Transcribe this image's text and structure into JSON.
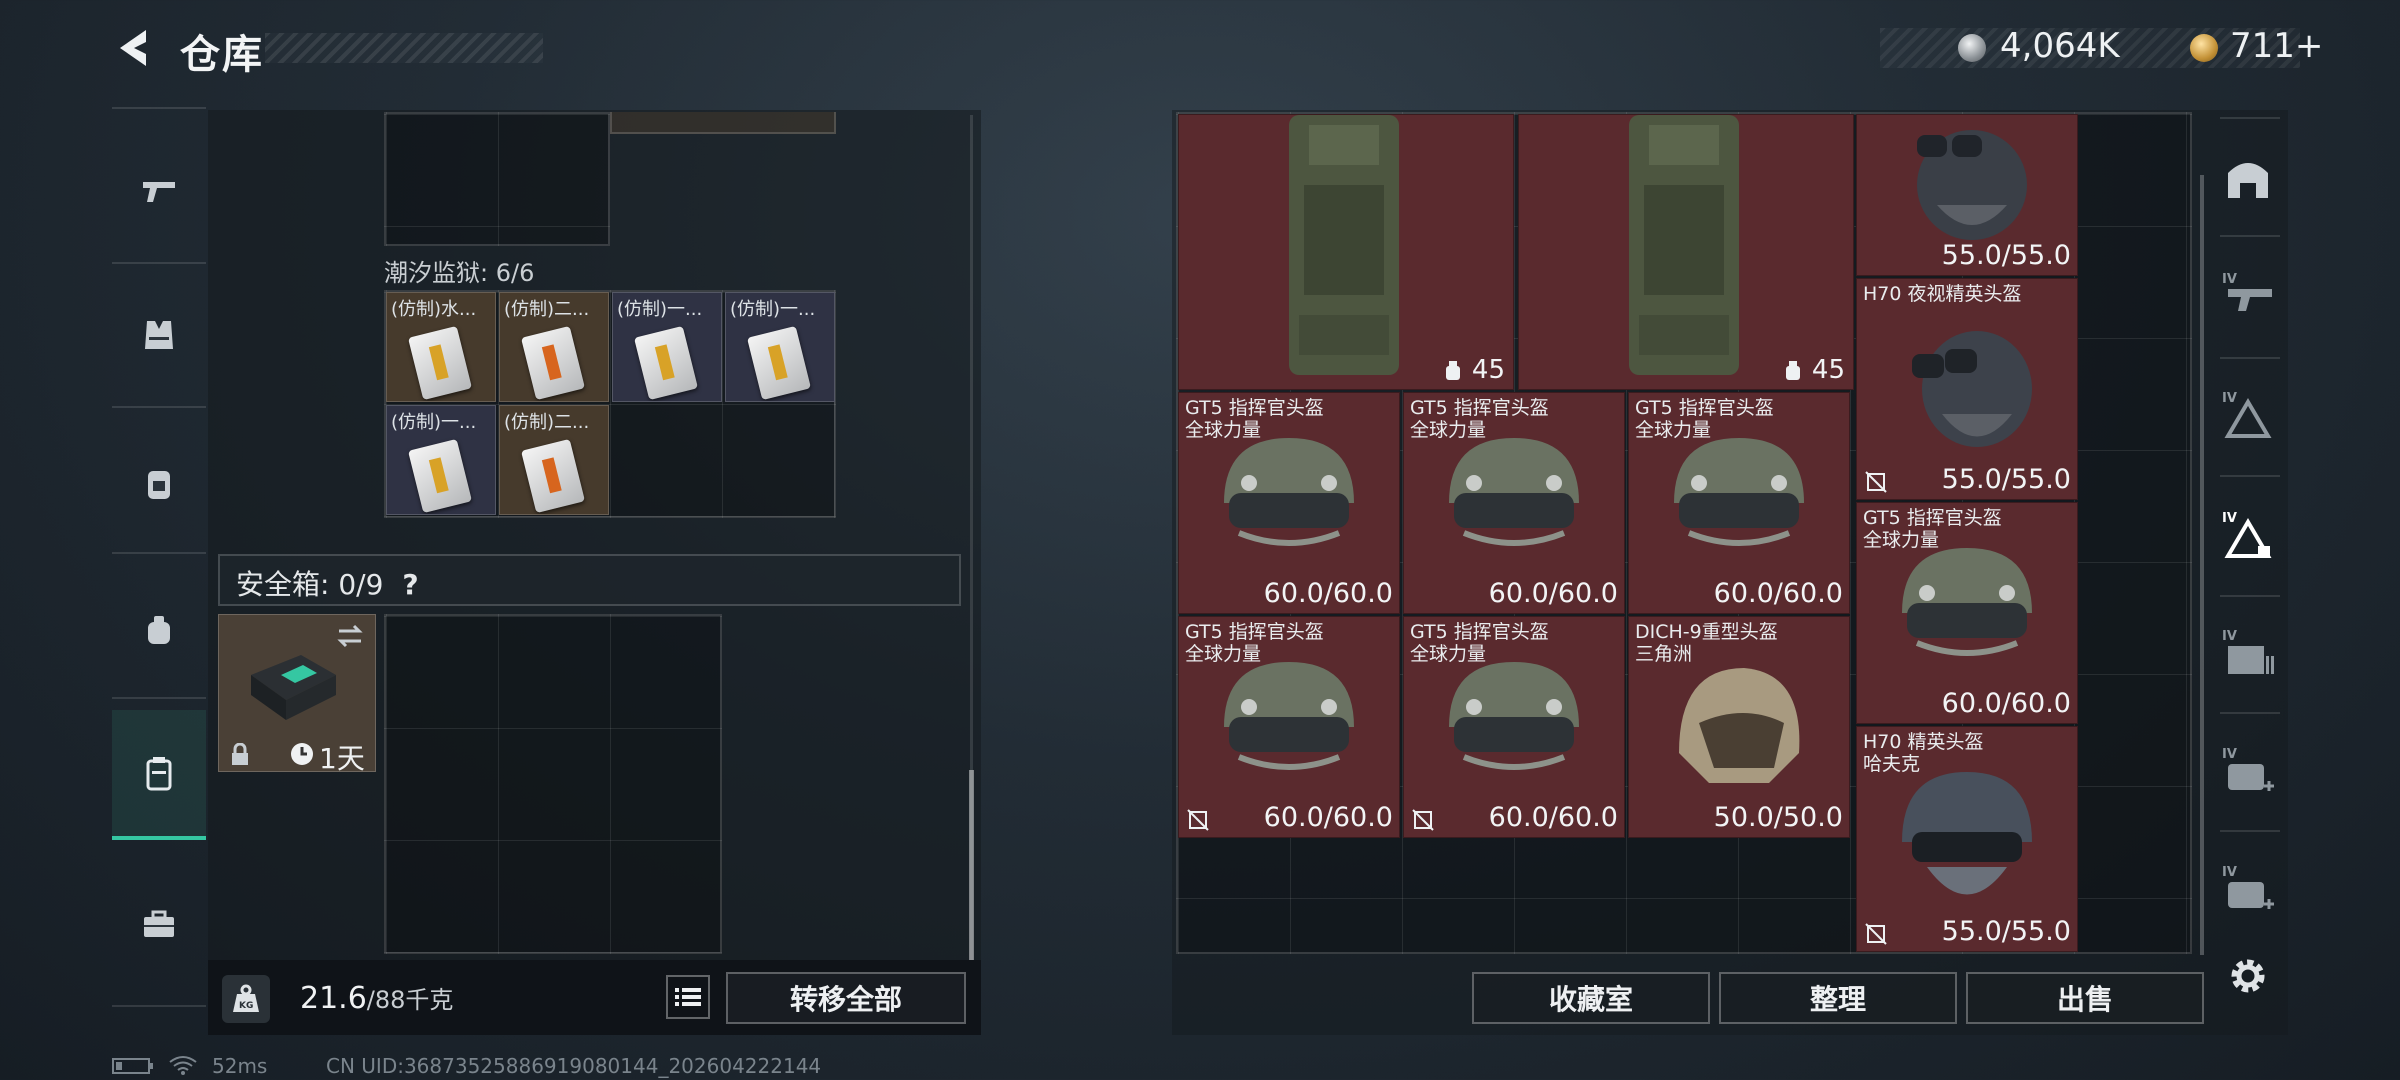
{
  "header": {
    "title": "仓库",
    "currency": [
      {
        "name": "silver-coin-icon",
        "amount": "4,064K"
      },
      {
        "name": "gold-coin-icon",
        "amount": "711+"
      }
    ]
  },
  "left_nav": {
    "icons": [
      "pistol-icon",
      "vest-icon",
      "backpack-icon",
      "pouch-icon",
      "safe-case-icon",
      "briefcase-icon"
    ],
    "active": "safe-case-icon"
  },
  "storage": {
    "prison_label": "潮汐监狱: 6/6",
    "cards": [
      {
        "label": "(仿制)水...",
        "color": "brown",
        "stripe": "y"
      },
      {
        "label": "(仿制)二...",
        "color": "brown",
        "stripe": "o"
      },
      {
        "label": "(仿制)一...",
        "color": "purple",
        "stripe": "y"
      },
      {
        "label": "(仿制)一...",
        "color": "purple",
        "stripe": "y"
      },
      {
        "label": "(仿制)一...",
        "color": "purple",
        "stripe": "y"
      },
      {
        "label": "(仿制)二...",
        "color": "brown",
        "stripe": "o"
      }
    ],
    "safe_label": "安全箱: 0/9",
    "safe_help": "?",
    "safe_timer": "1天"
  },
  "footer_left": {
    "weight_current": "21.6",
    "weight_max": "/88千克",
    "transfer_all": "转移全部"
  },
  "inventory": {
    "vest_count": "45",
    "items": [
      {
        "name": "",
        "sub": "",
        "durability": "55.0/55.0",
        "nosell": false
      },
      {
        "name": "H70 夜视精英头盔",
        "sub": "",
        "durability": "55.0/55.0",
        "nosell": true
      },
      {
        "name": "GT5 指挥官头盔",
        "sub": "全球力量",
        "durability": "60.0/60.0",
        "nosell": false
      },
      {
        "name": "GT5 指挥官头盔",
        "sub": "全球力量",
        "durability": "60.0/60.0",
        "nosell": false
      },
      {
        "name": "GT5 指挥官头盔",
        "sub": "全球力量",
        "durability": "60.0/60.0",
        "nosell": false
      },
      {
        "name": "GT5 指挥官头盔",
        "sub": "全球力量",
        "durability": "60.0/60.0",
        "nosell": false
      },
      {
        "name": "GT5 指挥官头盔",
        "sub": "全球力量",
        "durability": "60.0/60.0",
        "nosell": true
      },
      {
        "name": "GT5 指挥官头盔",
        "sub": "全球力量",
        "durability": "60.0/60.0",
        "nosell": true
      },
      {
        "name": "DICH-9重型头盔",
        "sub": "三角洲",
        "durability": "50.0/50.0",
        "nosell": false
      },
      {
        "name": "H70 精英头盔",
        "sub": "哈夫克",
        "durability": "55.0/55.0",
        "nosell": true
      }
    ]
  },
  "actions": {
    "collection": "收藏室",
    "sort": "整理",
    "sell": "出售"
  },
  "right_nav": {
    "icons": [
      "armory-icon",
      "tier4-gun-icon",
      "tier4-armor-icon",
      "tier4-helmet-icon",
      "tier4-ammo-icon",
      "tier4-medkit-icon",
      "tier4-medkit-plus-icon",
      "settings-gear-icon"
    ],
    "active": "tier4-helmet-icon",
    "tier": "IV"
  },
  "status": {
    "ping": "52ms",
    "uid": "CN UID:3687352588691908014​4_202604222144"
  },
  "colors": {
    "accent": "#35c7a2",
    "item_bg": "#5a2a2e",
    "card_brown": "#463a2c",
    "card_purple": "#2f3244"
  }
}
